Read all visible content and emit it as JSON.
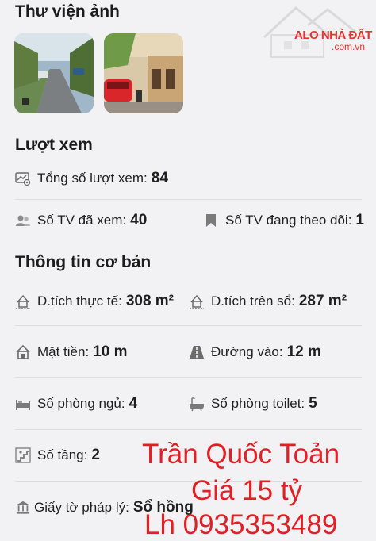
{
  "gallery": {
    "title": "Thư viện ảnh"
  },
  "watermark": {
    "brand": "ALO NHÀ ĐẤT",
    "domain": ".com.vn"
  },
  "views": {
    "title": "Lượt xem",
    "total_label": "Tổng số lượt xem:",
    "total_value": "84",
    "members_viewed_label": "Số TV đã xem:",
    "members_viewed_value": "40",
    "members_following_label": "Số TV đang theo dõi:",
    "members_following_value": "1"
  },
  "basic_info": {
    "title": "Thông tin cơ bản",
    "actual_area_label": "D.tích thực tế:",
    "actual_area_value": "308 m²",
    "book_area_label": "D.tích trên sổ:",
    "book_area_value": "287 m²",
    "frontage_label": "Mặt tiền:",
    "frontage_value": "10 m",
    "road_label": "Đường vào:",
    "road_value": "12 m",
    "bedrooms_label": "Số phòng ngủ:",
    "bedrooms_value": "4",
    "toilets_label": "Số phòng toilet:",
    "toilets_value": "5",
    "floors_label": "Số tầng:",
    "floors_value": "2",
    "legal_label": "Giấy tờ pháp lý:",
    "legal_value": "Sổ hồng"
  },
  "overlay": {
    "name": "Trần Quốc Toản",
    "price": "Giá 15 tỷ",
    "phone": "Lh 0935353489"
  },
  "colors": {
    "overlay_red": "#e31e24",
    "logo_red": "#e8312f",
    "icon_gray": "#6b6b6b"
  }
}
